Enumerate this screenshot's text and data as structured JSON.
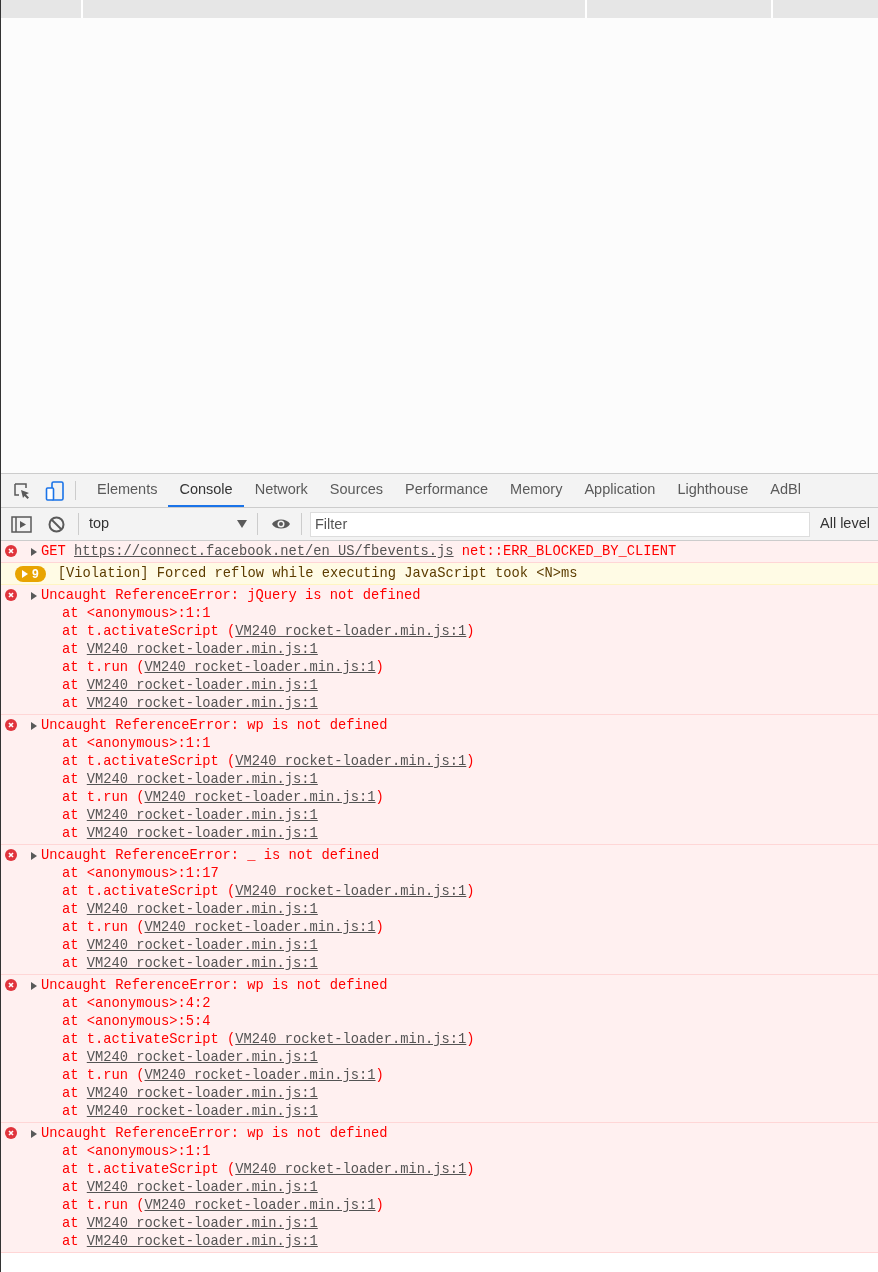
{
  "devtools": {
    "tabs": [
      {
        "label": "Elements",
        "selected": false
      },
      {
        "label": "Console",
        "selected": true
      },
      {
        "label": "Network",
        "selected": false
      },
      {
        "label": "Sources",
        "selected": false
      },
      {
        "label": "Performance",
        "selected": false
      },
      {
        "label": "Memory",
        "selected": false
      },
      {
        "label": "Application",
        "selected": false
      },
      {
        "label": "Lighthouse",
        "selected": false
      },
      {
        "label": "AdBl",
        "selected": false
      }
    ],
    "context": "top",
    "filter": {
      "placeholder": "Filter"
    },
    "levels": "All level"
  },
  "messages": [
    {
      "kind": "error",
      "parts": [
        {
          "text": "GET "
        },
        {
          "link": "https://connect.facebook.net/en_US/fbevents.js"
        },
        {
          "text": " net::ERR_BLOCKED_BY_CLIENT"
        }
      ]
    },
    {
      "kind": "warning",
      "count": "9",
      "parts": [
        {
          "text": "[Violation] Forced reflow while executing JavaScript took <N>ms"
        }
      ]
    },
    {
      "kind": "error",
      "parts": [
        {
          "text": "Uncaught ReferenceError: jQuery is not defined"
        }
      ],
      "frames": [
        {
          "pre": "at <anonymous>:1:1"
        },
        {
          "pre": "at t.activateScript (",
          "link": "VM240 rocket-loader.min.js:1",
          "post": ")"
        },
        {
          "pre": "at ",
          "link": "VM240 rocket-loader.min.js:1"
        },
        {
          "pre": "at t.run (",
          "link": "VM240 rocket-loader.min.js:1",
          "post": ")"
        },
        {
          "pre": "at ",
          "link": "VM240 rocket-loader.min.js:1"
        },
        {
          "pre": "at ",
          "link": "VM240 rocket-loader.min.js:1"
        }
      ]
    },
    {
      "kind": "error",
      "parts": [
        {
          "text": "Uncaught ReferenceError: wp is not defined"
        }
      ],
      "frames": [
        {
          "pre": "at <anonymous>:1:1"
        },
        {
          "pre": "at t.activateScript (",
          "link": "VM240 rocket-loader.min.js:1",
          "post": ")"
        },
        {
          "pre": "at ",
          "link": "VM240 rocket-loader.min.js:1"
        },
        {
          "pre": "at t.run (",
          "link": "VM240 rocket-loader.min.js:1",
          "post": ")"
        },
        {
          "pre": "at ",
          "link": "VM240 rocket-loader.min.js:1"
        },
        {
          "pre": "at ",
          "link": "VM240 rocket-loader.min.js:1"
        }
      ]
    },
    {
      "kind": "error",
      "parts": [
        {
          "text": "Uncaught ReferenceError: _ is not defined"
        }
      ],
      "frames": [
        {
          "pre": "at <anonymous>:1:17"
        },
        {
          "pre": "at t.activateScript (",
          "link": "VM240 rocket-loader.min.js:1",
          "post": ")"
        },
        {
          "pre": "at ",
          "link": "VM240 rocket-loader.min.js:1"
        },
        {
          "pre": "at t.run (",
          "link": "VM240 rocket-loader.min.js:1",
          "post": ")"
        },
        {
          "pre": "at ",
          "link": "VM240 rocket-loader.min.js:1"
        },
        {
          "pre": "at ",
          "link": "VM240 rocket-loader.min.js:1"
        }
      ]
    },
    {
      "kind": "error",
      "parts": [
        {
          "text": "Uncaught ReferenceError: wp is not defined"
        }
      ],
      "frames": [
        {
          "pre": "at <anonymous>:4:2"
        },
        {
          "pre": "at <anonymous>:5:4"
        },
        {
          "pre": "at t.activateScript (",
          "link": "VM240 rocket-loader.min.js:1",
          "post": ")"
        },
        {
          "pre": "at ",
          "link": "VM240 rocket-loader.min.js:1"
        },
        {
          "pre": "at t.run (",
          "link": "VM240 rocket-loader.min.js:1",
          "post": ")"
        },
        {
          "pre": "at ",
          "link": "VM240 rocket-loader.min.js:1"
        },
        {
          "pre": "at ",
          "link": "VM240 rocket-loader.min.js:1"
        }
      ]
    },
    {
      "kind": "error",
      "parts": [
        {
          "text": "Uncaught ReferenceError: wp is not defined"
        }
      ],
      "frames": [
        {
          "pre": "at <anonymous>:1:1"
        },
        {
          "pre": "at t.activateScript (",
          "link": "VM240 rocket-loader.min.js:1",
          "post": ")"
        },
        {
          "pre": "at ",
          "link": "VM240 rocket-loader.min.js:1"
        },
        {
          "pre": "at t.run (",
          "link": "VM240 rocket-loader.min.js:1",
          "post": ")"
        },
        {
          "pre": "at ",
          "link": "VM240 rocket-loader.min.js:1"
        },
        {
          "pre": "at ",
          "link": "VM240 rocket-loader.min.js:1"
        }
      ]
    }
  ]
}
